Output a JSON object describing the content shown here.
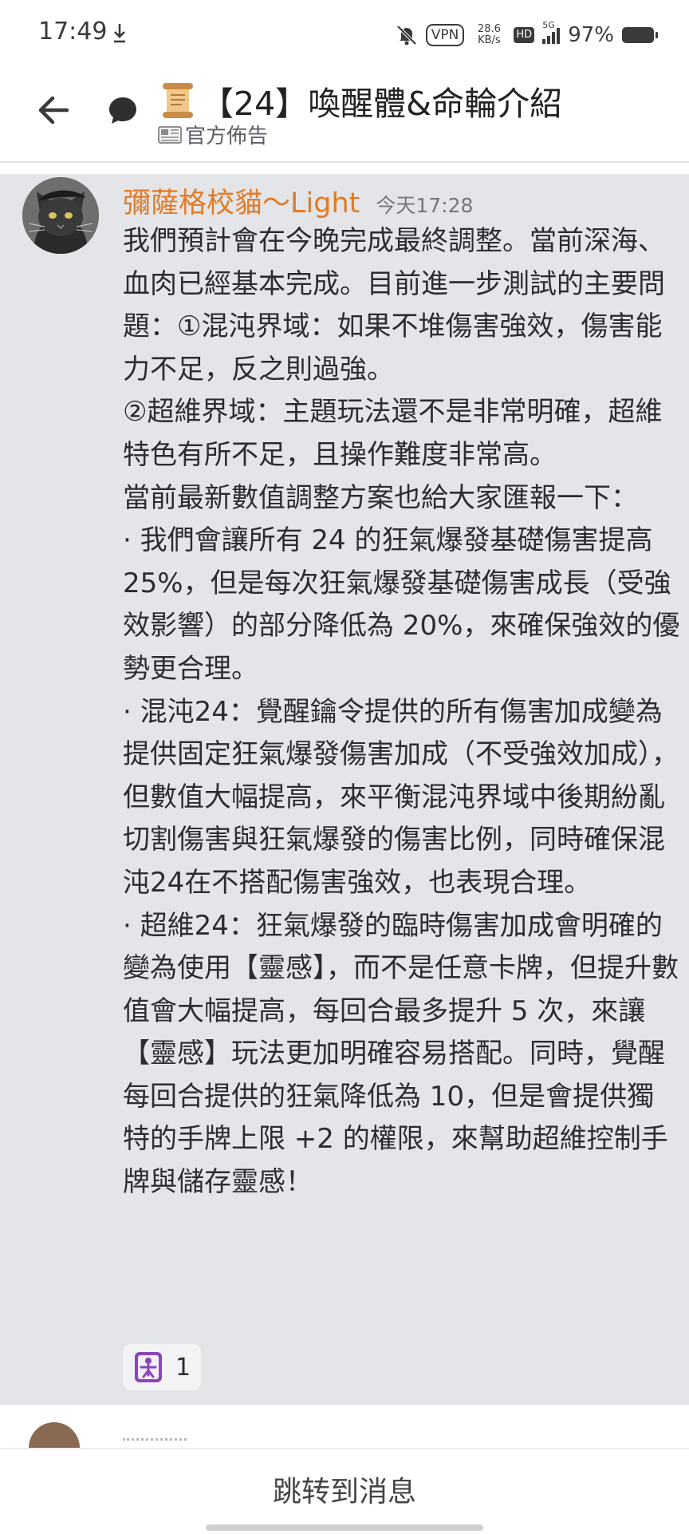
{
  "status_bar": {
    "time": "17:49",
    "vpn": "VPN",
    "net_speed_value": "28.6",
    "net_speed_unit": "KB/s",
    "hd": "HD",
    "network": "5G",
    "battery": "97%",
    "battery_level": 0.97
  },
  "header": {
    "title": "【24】喚醒體&命輪介紹",
    "channel": "官方佈告"
  },
  "message": {
    "author": "彌薩格校貓～Light",
    "timestamp": "今天17:28",
    "author_color": "#e07b27",
    "paragraphs": [
      "我們預計會在今晚完成最終調整。當前深海、血肉已經基本完成。目前進一步測試的主要問題：①混沌界域：如果不堆傷害強效，傷害能力不足，反之則過強。",
      "②超維界域：主題玩法還不是非常明確，超維特色有所不足，且操作難度非常高。",
      "當前最新數值調整方案也給大家匯報一下：",
      "· 我們會讓所有 24 的狂氣爆發基礎傷害提高 25%，但是每次狂氣爆發基礎傷害成長（受強效影響）的部分降低為 20%，來確保強效的優勢更合理。",
      "· 混沌24：覺醒鑰令提供的所有傷害加成變為提供固定狂氣爆發傷害加成（不受強效加成），但數值大幅提高，來平衡混沌界域中後期紛亂切割傷害與狂氣爆發的傷害比例，同時確保混沌24在不搭配傷害強效，也表現合理。",
      "· 超維24：狂氣爆發的臨時傷害加成會明確的變為使用【靈感】，而不是任意卡牌，但提升數值會大幅提高，每回合最多提升 5 次，來讓【靈感】玩法更加明確容易搭配。同時，覺醒每回合提供的狂氣降低為 10，但是會提供獨特的手牌上限 +2 的權限，來幫助超維控制手牌與儲存靈感！"
    ],
    "reaction": {
      "icon": "purple-figure-emoji-icon",
      "count": "1"
    }
  },
  "footer": {
    "jump_label": "跳转到消息"
  }
}
